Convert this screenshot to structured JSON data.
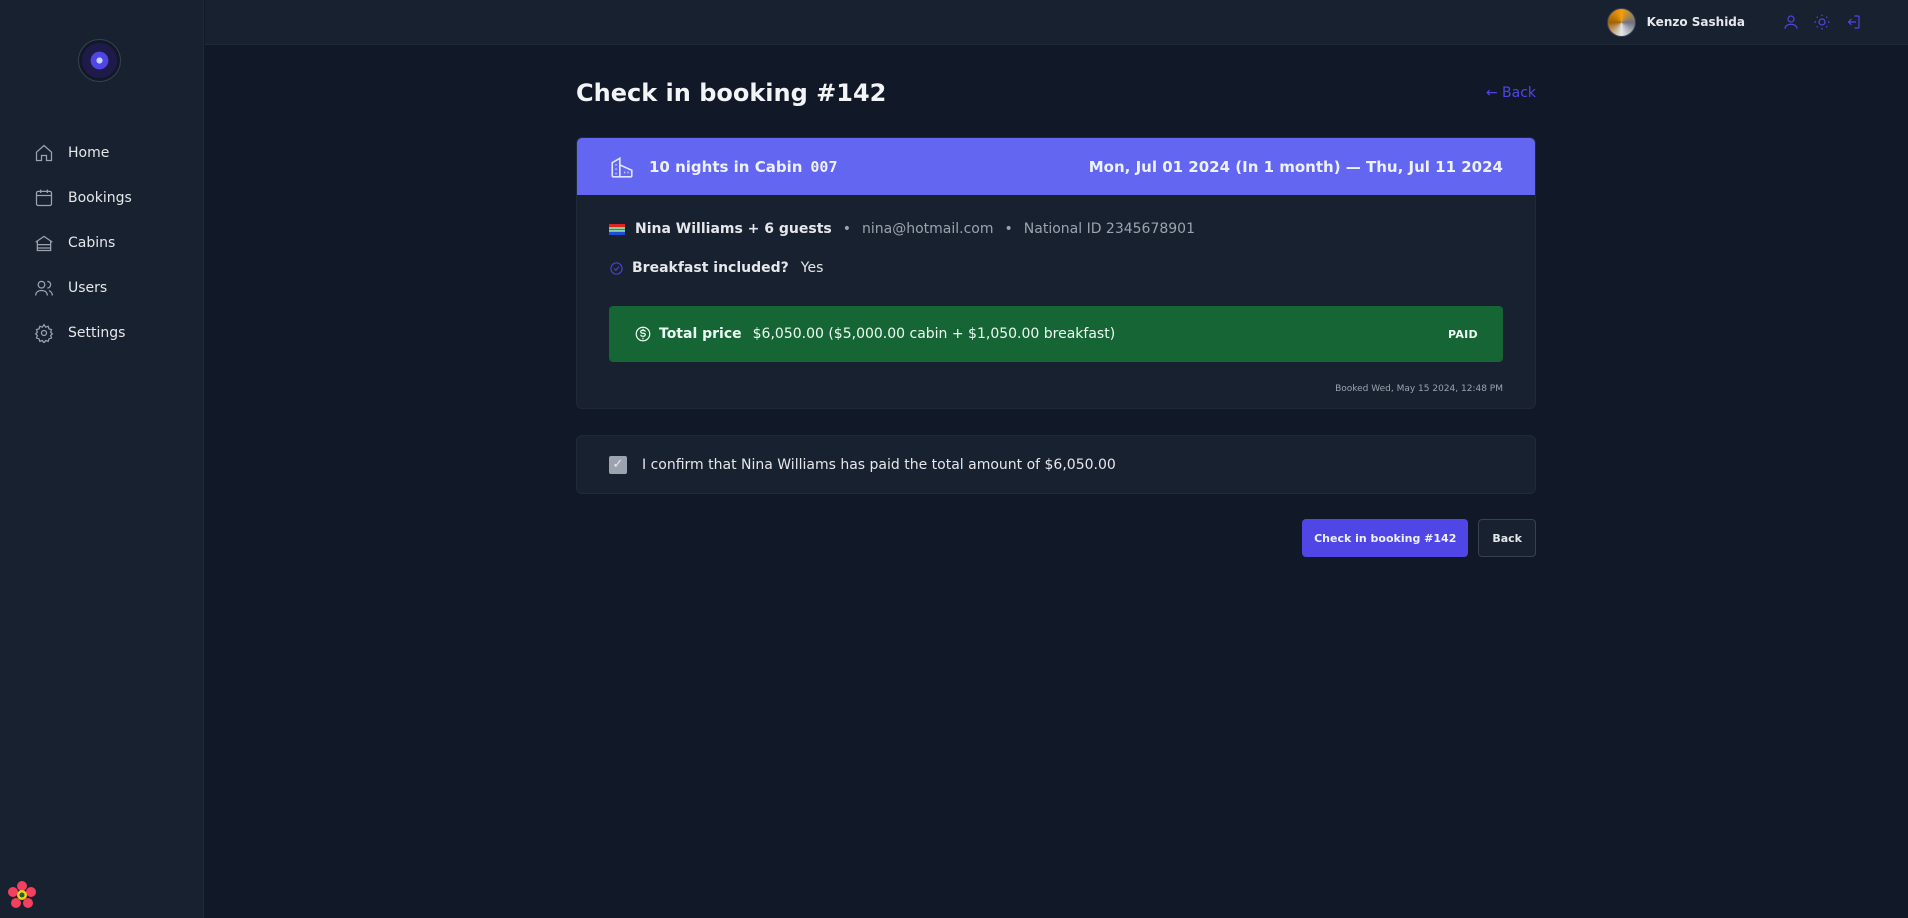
{
  "sidebar": {
    "items": [
      {
        "label": "Home",
        "icon": "home-icon"
      },
      {
        "label": "Bookings",
        "icon": "calendar-icon"
      },
      {
        "label": "Cabins",
        "icon": "cabin-icon"
      },
      {
        "label": "Users",
        "icon": "users-icon"
      },
      {
        "label": "Settings",
        "icon": "gear-icon"
      }
    ]
  },
  "header": {
    "username": "Kenzo Sashida",
    "icons": [
      "user-icon",
      "sun-icon",
      "logout-icon"
    ]
  },
  "page": {
    "title": "Check in booking #142",
    "back_link": "← Back"
  },
  "booking": {
    "nights_text": "10 nights in Cabin",
    "cabin_code": "007",
    "dates": "Mon, Jul 01 2024 (In 1 month) — Thu, Jul 11 2024",
    "guest": "Nina Williams + 6 guests",
    "dot": "•",
    "email": "nina@hotmail.com",
    "national_id": "National ID 2345678901",
    "breakfast_label": "Breakfast included?",
    "breakfast_value": "Yes",
    "price_label": "Total price",
    "price_value": "$6,050.00 ($5,000.00 cabin + $1,050.00 breakfast)",
    "status": "PAID",
    "booked_at": "Booked Wed, May 15 2024, 12:48 PM"
  },
  "confirm": {
    "checked": true,
    "check_mark": "✓",
    "text": "I confirm that Nina Williams has paid the total amount of $6,050.00"
  },
  "actions": {
    "checkin_label": "Check in booking #142",
    "back_label": "Back"
  },
  "colors": {
    "accent": "#4f46e5",
    "header_bar": "#6366f1",
    "paid_green": "#166534",
    "background": "#111827"
  }
}
